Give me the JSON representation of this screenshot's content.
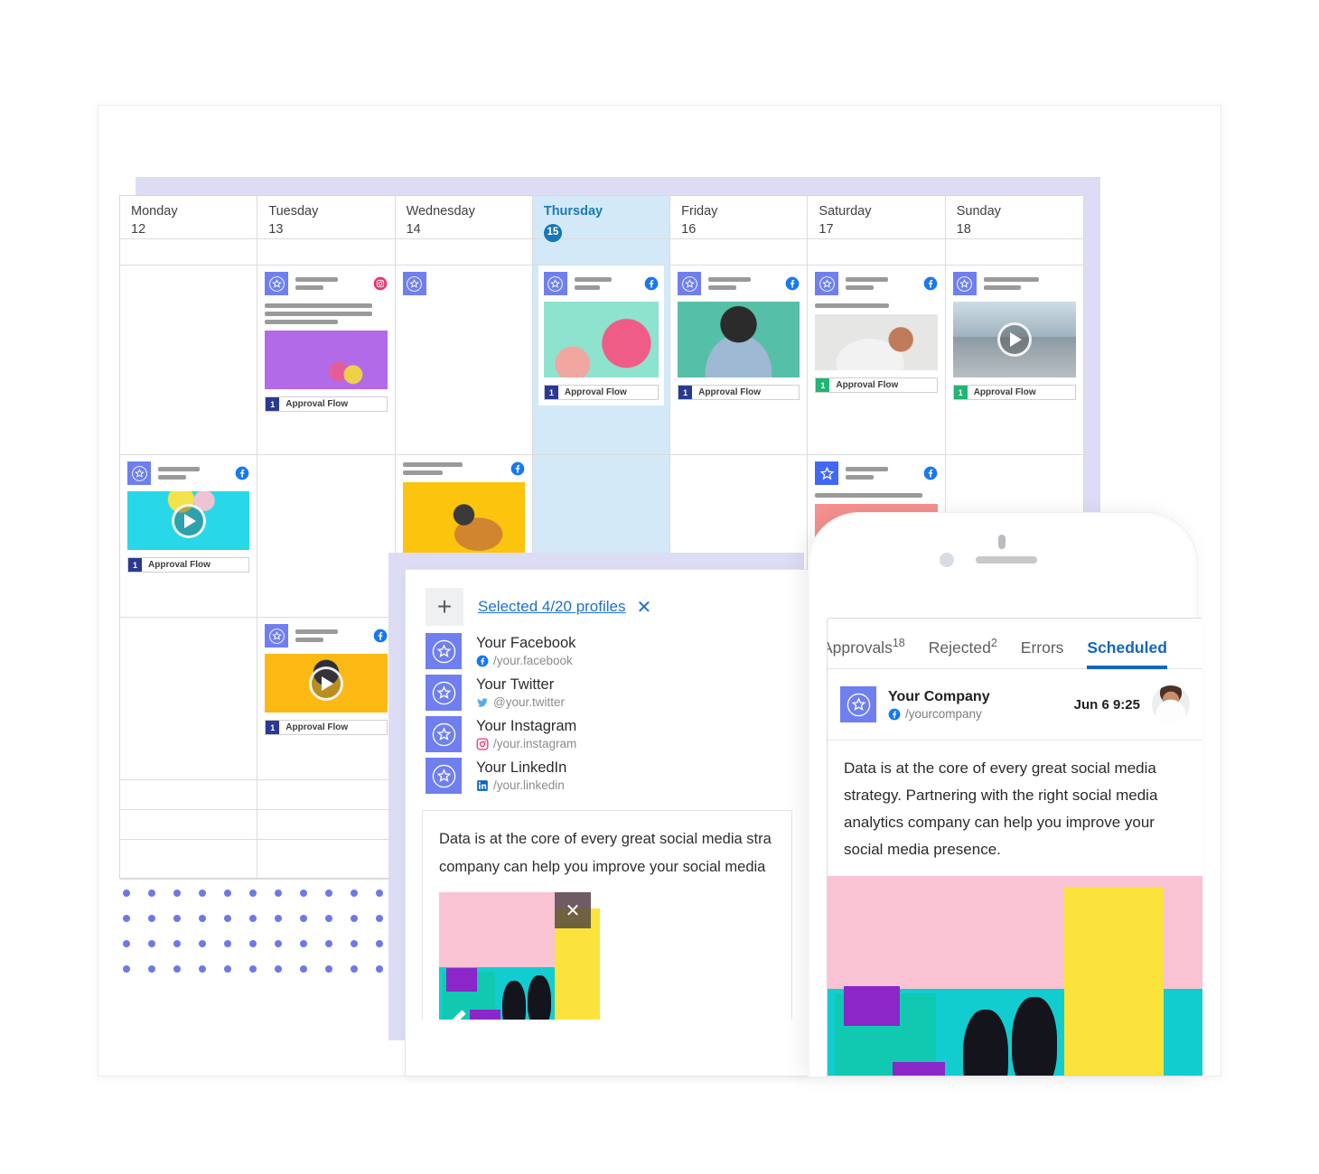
{
  "calendar": {
    "days": [
      {
        "name": "Monday",
        "num": "12",
        "today": false
      },
      {
        "name": "Tuesday",
        "num": "13",
        "today": false
      },
      {
        "name": "Wednesday",
        "num": "14",
        "today": false
      },
      {
        "name": "Thursday",
        "num": "15",
        "today": true
      },
      {
        "name": "Friday",
        "num": "16",
        "today": false
      },
      {
        "name": "Saturday",
        "num": "17",
        "today": false
      },
      {
        "name": "Sunday",
        "num": "18",
        "today": false
      }
    ],
    "approval_label": "Approval Flow",
    "approval_count": "1",
    "cards": {
      "tue_r1": {
        "network": "instagram-icon",
        "approval_label": "Approval Flow",
        "approval_count": "1",
        "approval_color": "#2a3a93"
      },
      "thu_r1": {
        "network": "facebook-icon",
        "approval_label": "Approval Flow",
        "approval_count": "1",
        "approval_color": "#2a3a93"
      },
      "fri_r1": {
        "network": "facebook-icon",
        "approval_label": "Approval Flow",
        "approval_count": "1",
        "approval_color": "#2a3a93"
      },
      "sat_r1": {
        "network": "facebook-icon",
        "approval_label": "Approval Flow",
        "approval_count": "1",
        "approval_color": "#22b573"
      },
      "sun_r1": {
        "network": "none",
        "approval_label": "Approval Flow",
        "approval_count": "1",
        "approval_color": "#22b573"
      },
      "mon_r2": {
        "network": "facebook-icon",
        "approval_label": "Approval Flow",
        "approval_count": "1",
        "approval_color": "#2a3a93"
      },
      "wed_r2": {
        "network": "facebook-icon"
      },
      "sat_r2": {
        "network": "facebook-icon"
      },
      "tue_r3": {
        "network": "facebook-icon",
        "approval_label": "Approval Flow",
        "approval_count": "1",
        "approval_color": "#2a3a93"
      }
    }
  },
  "composer": {
    "add_profile_icon": "plus-icon",
    "selected_label": "Selected 4/20 profiles",
    "close_icon": "close-icon",
    "profiles": [
      {
        "name": "Your Facebook",
        "handle": "/your.facebook",
        "network": "facebook-icon",
        "avatar_icon": "star-avatar-icon"
      },
      {
        "name": "Your Twitter",
        "handle": "@your.twitter",
        "network": "twitter-icon",
        "avatar_icon": "star-avatar-icon"
      },
      {
        "name": "Your Instagram",
        "handle": "/your.instagram",
        "network": "instagram-icon",
        "avatar_icon": "star-avatar-icon"
      },
      {
        "name": "Your LinkedIn",
        "handle": "/your.linkedin",
        "network": "linkedin-icon",
        "avatar_icon": "star-avatar-icon"
      }
    ],
    "text_line1": "Data is at the core of every great social media stra",
    "text_line2": "company can help you improve your social media",
    "attachment_remove_icon": "close-icon",
    "attachment_edit_icon": "pencil-icon"
  },
  "phone": {
    "tabs": [
      {
        "label": "Approvals",
        "badge": "18",
        "active": false
      },
      {
        "label": "Rejected",
        "badge": "2",
        "active": false
      },
      {
        "label": "Errors",
        "badge": "",
        "active": false
      },
      {
        "label": "Scheduled",
        "badge": "",
        "active": true
      }
    ],
    "post": {
      "account_name": "Your Company",
      "account_handle": "/yourcompany",
      "account_network": "facebook-icon",
      "avatar_icon": "star-avatar-icon",
      "date": "Jun 6 9:25",
      "author_avatar": "user-photo",
      "text": "Data is at the core of every great social media strategy. Partnering with the right social media analytics company can help you improve your social media presence."
    }
  },
  "colors": {
    "accent_blue": "#1565c0",
    "avatar_purple": "#6f7ff0",
    "today_bg": "#d3e9f7",
    "panel_shadow": "#dcdcf5",
    "dot_strong": "#6e78e8",
    "dot_light": "#d6d8f5",
    "approval_blue": "#2a3a93",
    "approval_green": "#22b573"
  }
}
